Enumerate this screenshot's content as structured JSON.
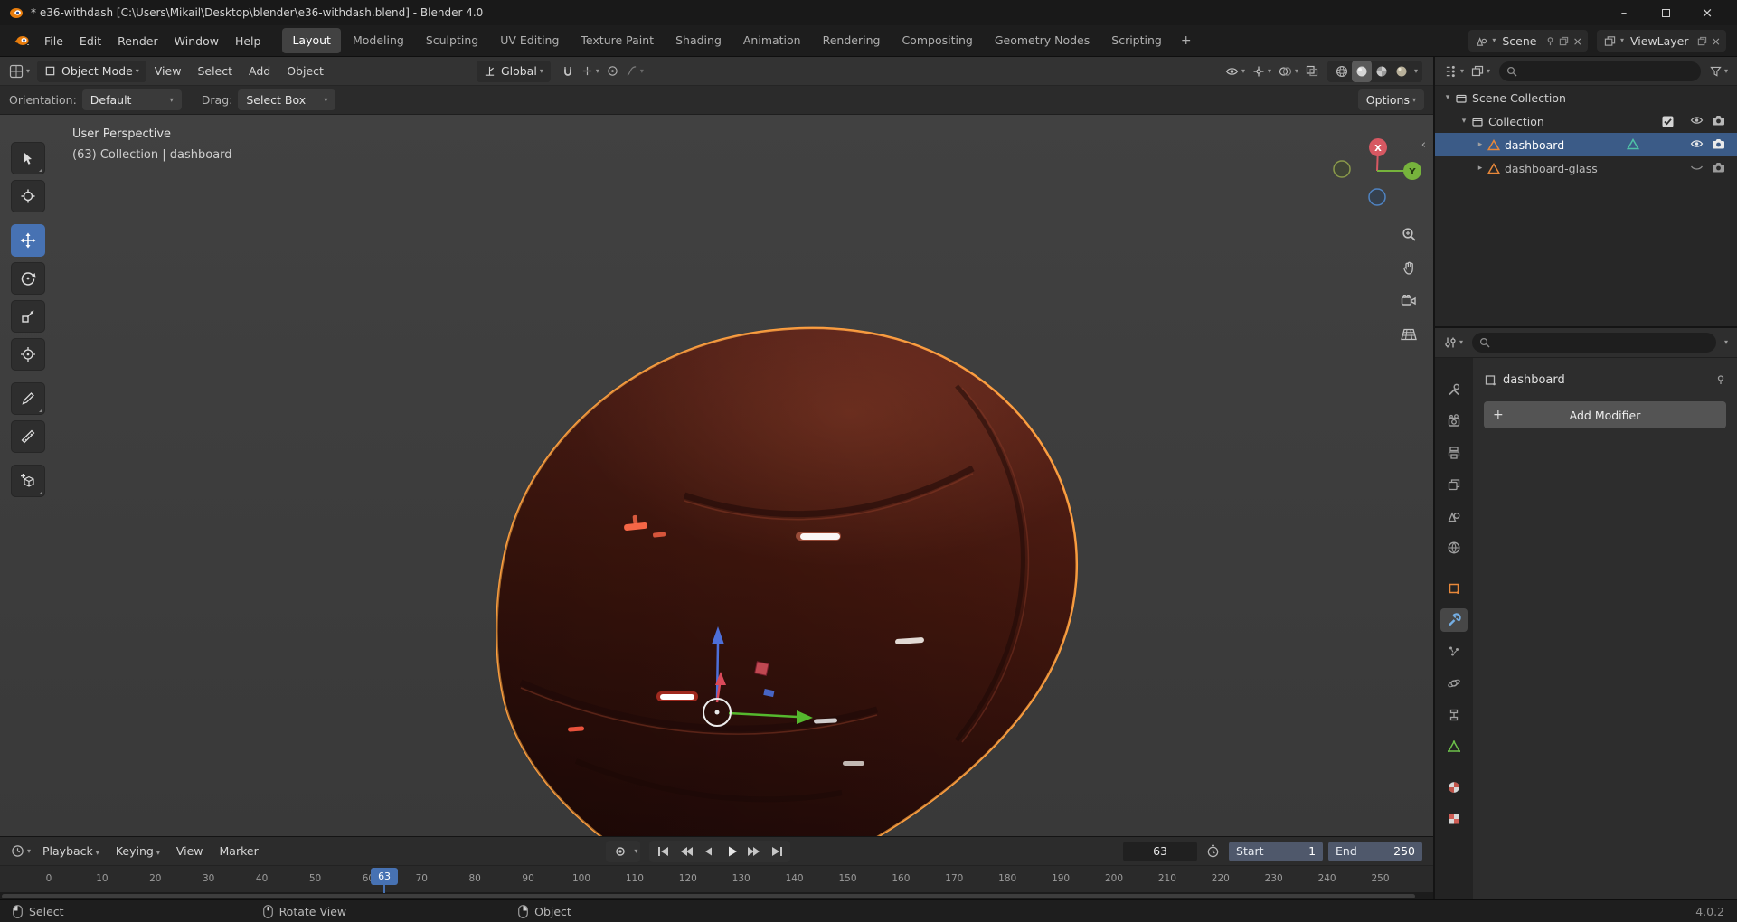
{
  "window": {
    "title": "* e36-withdash [C:\\Users\\Mikail\\Desktop\\blender\\e36-withdash.blend] - Blender 4.0"
  },
  "glyphs": {
    "caret_down": "▾",
    "expand_open": "▾",
    "expand_closed": "▸",
    "close": "×",
    "minimize": "–",
    "chevron_left": "‹",
    "plus": "+"
  },
  "topbar": {
    "menus": [
      "File",
      "Edit",
      "Render",
      "Window",
      "Help"
    ],
    "workspaces": [
      "Layout",
      "Modeling",
      "Sculpting",
      "UV Editing",
      "Texture Paint",
      "Shading",
      "Animation",
      "Rendering",
      "Compositing",
      "Geometry Nodes",
      "Scripting"
    ],
    "add_workspace": "+",
    "scene_value": "Scene",
    "view_layer_value": "ViewLayer"
  },
  "viewport": {
    "header": {
      "mode": "Object Mode",
      "menus": [
        "View",
        "Select",
        "Add",
        "Object"
      ],
      "orientation": "Global"
    },
    "tool_settings": {
      "orientation_label": "Orientation:",
      "orientation_value": "Default",
      "drag_label": "Drag:",
      "drag_value": "Select Box",
      "options": "Options"
    },
    "overlay": {
      "perspective": "User Perspective",
      "context": "(63) Collection | dashboard"
    },
    "gizmo": {
      "x_label": "X",
      "y_label": "Y"
    }
  },
  "outliner": {
    "scene_collection": "Scene Collection",
    "collection": "Collection",
    "objects": [
      "dashboard",
      "dashboard-glass"
    ],
    "selected_object": "dashboard"
  },
  "properties": {
    "object_name": "dashboard",
    "add_modifier": "Add Modifier",
    "tabs": [
      "tool",
      "render",
      "output",
      "view-layer",
      "scene",
      "world",
      "object",
      "modifiers",
      "particles",
      "physics",
      "constraints",
      "object-data",
      "material",
      "texture"
    ],
    "active_tab": "modifiers"
  },
  "timeline": {
    "menus": [
      "Playback",
      "Keying",
      "View",
      "Marker"
    ],
    "current_frame": 63,
    "start_label": "Start",
    "start_value": "1",
    "end_label": "End",
    "end_value": "250",
    "ticks": [
      0,
      10,
      20,
      30,
      40,
      50,
      60,
      70,
      80,
      90,
      100,
      110,
      120,
      130,
      140,
      150,
      160,
      170,
      180,
      190,
      200,
      210,
      220,
      230,
      240,
      250
    ]
  },
  "status_bar": {
    "hints": [
      "Select",
      "Rotate View",
      "Object"
    ],
    "version": "4.0.2"
  },
  "colors": {
    "accent": "#4772b3",
    "selection_outline": "#ffa040",
    "object_icon": "#e8883a",
    "axis_x": "#d75862",
    "axis_y": "#76b33c",
    "axis_z": "#4a7fd0"
  }
}
